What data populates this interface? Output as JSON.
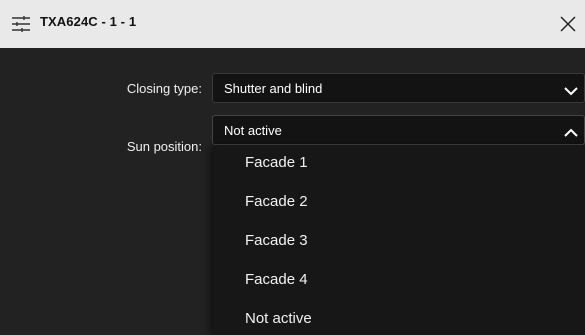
{
  "window": {
    "title": "TXA624C - 1 - 1",
    "settings_icon": "sliders-icon",
    "close_icon": "close-icon"
  },
  "form": {
    "closing_type": {
      "label": "Closing type:",
      "value": "Shutter and blind",
      "chevron_icon": "chevron-down-icon"
    },
    "sun_position": {
      "label": "Sun position:",
      "value": "Not active",
      "chevron_icon": "chevron-up-icon",
      "expanded": true,
      "options": [
        "Facade 1",
        "Facade 2",
        "Facade 3",
        "Facade 4",
        "Not active"
      ]
    }
  },
  "colors": {
    "titlebar_bg": "#e9e9e9",
    "panel_bg": "#222222",
    "select_bg": "#131313",
    "dropdown_bg": "#171717",
    "text_light": "#ffffff",
    "text_dark": "#111111"
  }
}
